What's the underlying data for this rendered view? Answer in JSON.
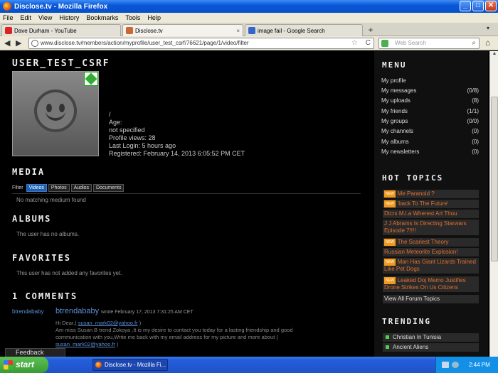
{
  "window": {
    "title": "Disclose.tv - Mozilla Firefox",
    "minimize": "_",
    "maximize": "□",
    "close": "✕"
  },
  "menubar": [
    "File",
    "Edit",
    "View",
    "History",
    "Bookmarks",
    "Tools",
    "Help"
  ],
  "tabs": [
    {
      "label": "Dave Durham - YouTube",
      "icon_color": "#d22"
    },
    {
      "label": "Disclose.tv",
      "icon_color": "#c63"
    },
    {
      "label": "image fail - Google Search",
      "icon_color": "#36c"
    }
  ],
  "tab_close": "×",
  "new_tab": "+",
  "tab_menu": "▾",
  "nav": {
    "url": "www.disclose.tv/members/action/myprofile/user_test_csrf/76621/page/1/video/filter",
    "search_placeholder": "Web Search",
    "back_icon": "◀",
    "forward_icon": "▶",
    "star_icon": "☆",
    "reload_icon": "C",
    "search_icon": "⌕",
    "home_icon": "⌂"
  },
  "profile": {
    "username": "USER_TEST_CSRF",
    "slash": "/",
    "age_label": "Age:",
    "age_value": "not specified",
    "views": "Profile views: 28",
    "last_login": "Last Login: 5 hours ago",
    "registered": "Registered: February 14, 2013 6:05:52 PM CET"
  },
  "media": {
    "heading": "MEDIA",
    "filter_label": "Filter",
    "filters": [
      "Videos",
      "Photos",
      "Audios",
      "Documents"
    ],
    "empty": "No matching medium found"
  },
  "albums": {
    "heading": "ALBUMS",
    "empty": "The user has no albums."
  },
  "favorites": {
    "heading": "FAVORITES",
    "empty": "This user has not added any favorites yet."
  },
  "comments": {
    "heading": "1 COMMENTS",
    "user_left": "btrendababy",
    "author": "btrendababy",
    "wrote": "wrote February 17, 2013 7:31:25 AM CET",
    "body_1": "Hi Dear,(",
    "email": "susan_mark02@yahoo.fr",
    "body_1b": ")",
    "body_2": "Am miss Susan B trend Zokoya ,It is my desire to contact you today for a lasting friendship and good communication with you,Write me back with my email address for my picture and more about (",
    "body_2b": ")"
  },
  "sidebar": {
    "menu_heading": "MENU",
    "menu": [
      {
        "label": "My profile",
        "count": ""
      },
      {
        "label": "My messages",
        "count": "(0/8)"
      },
      {
        "label": "My uploads",
        "count": "(8)"
      },
      {
        "label": "My friends",
        "count": "(1/1)"
      },
      {
        "label": "My groups",
        "count": "(0/0)"
      },
      {
        "label": "My channels",
        "count": "(0)"
      },
      {
        "label": "My albums",
        "count": "(0)"
      },
      {
        "label": "My newsletters",
        "count": "(0)"
      }
    ],
    "topics_heading": "HOT TOPICS",
    "new_badge": "NEW",
    "topics": [
      {
        "label": "Me Paranoid ?",
        "new": true
      },
      {
        "label": "'back To The Future'",
        "new": true
      },
      {
        "label": "Dtcrs M.i.a Wherest Art Thou",
        "new": false
      },
      {
        "label": "J J Abrams Is Directing Starwars Episode 7!!!!",
        "new": false
      },
      {
        "label": "The Scariest Theory",
        "new": true
      },
      {
        "label": "Russian Meteorite Explosion!",
        "new": false
      },
      {
        "label": "Man Has Giant Lizards Trained Like Pet Dogs",
        "new": true
      },
      {
        "label": "Leaked Doj Memo Justifies Drone Strikes On Us Citizens",
        "new": true
      }
    ],
    "view_all": "View All Forum Topics",
    "trending_heading": "TRENDING",
    "trending": [
      "Christian In Tunisia",
      "Ancient Aliens"
    ]
  },
  "feedback": "Feedback",
  "taskbar": {
    "start": "start",
    "item": "Disclose.tv - Mozilla Fi...",
    "clock": "2:44 PM"
  }
}
